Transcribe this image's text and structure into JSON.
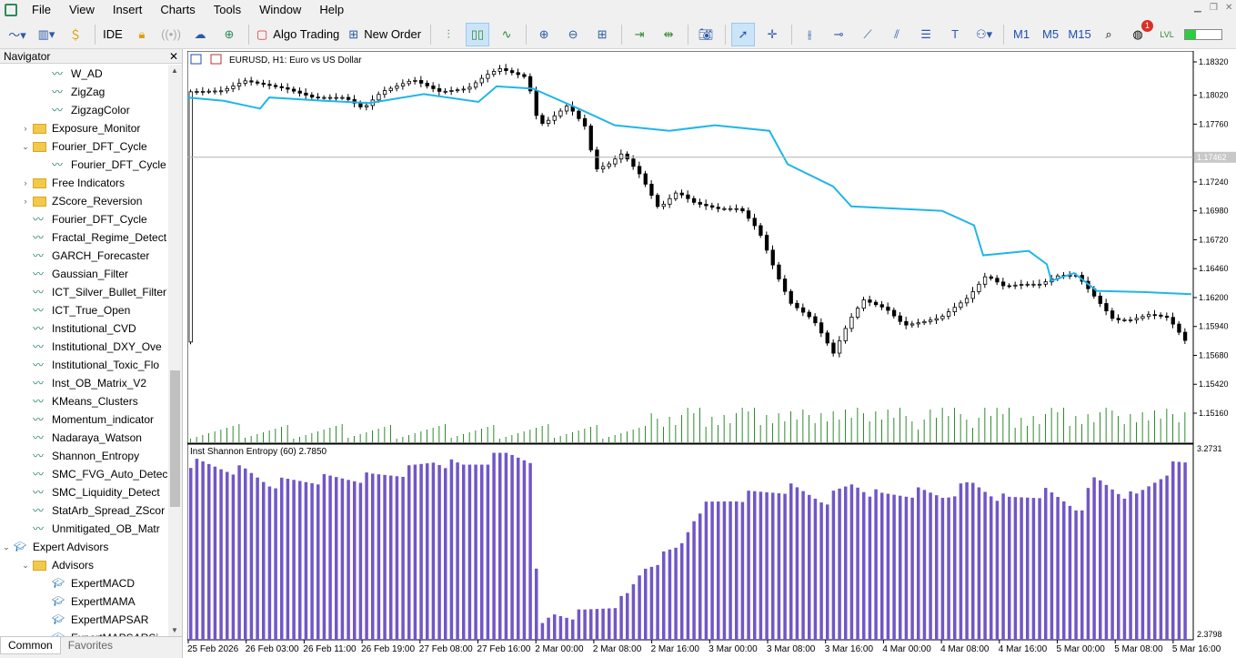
{
  "menu": {
    "items": [
      "File",
      "View",
      "Insert",
      "Charts",
      "Tools",
      "Window",
      "Help"
    ]
  },
  "toolbar": {
    "ide_label": "IDE",
    "algo_trading_label": "Algo Trading",
    "new_order_label": "New Order",
    "timeframes": [
      "M1",
      "M5",
      "M15"
    ],
    "notification_count": "1"
  },
  "navigator": {
    "title": "Navigator",
    "items": [
      {
        "label": "W_AD",
        "type": "indicator",
        "level": 2
      },
      {
        "label": "ZigZag",
        "type": "indicator",
        "level": 2
      },
      {
        "label": "ZigzagColor",
        "type": "indicator",
        "level": 2
      },
      {
        "label": "Exposure_Monitor",
        "type": "folder",
        "level": 1,
        "expander": "collapsed"
      },
      {
        "label": "Fourier_DFT_Cycle",
        "type": "folder",
        "level": 1,
        "expander": "expanded"
      },
      {
        "label": "Fourier_DFT_Cycle",
        "type": "indicator",
        "level": 2
      },
      {
        "label": "Free Indicators",
        "type": "folder",
        "level": 1,
        "expander": "collapsed"
      },
      {
        "label": "ZScore_Reversion",
        "type": "folder",
        "level": 1,
        "expander": "collapsed"
      },
      {
        "label": "Fourier_DFT_Cycle",
        "type": "indicator",
        "level": 1
      },
      {
        "label": "Fractal_Regime_Detect",
        "type": "indicator",
        "level": 1
      },
      {
        "label": "GARCH_Forecaster",
        "type": "indicator",
        "level": 1
      },
      {
        "label": "Gaussian_Filter",
        "type": "indicator",
        "level": 1
      },
      {
        "label": "ICT_Silver_Bullet_Filter",
        "type": "indicator",
        "level": 1
      },
      {
        "label": "ICT_True_Open",
        "type": "indicator",
        "level": 1
      },
      {
        "label": "Institutional_CVD",
        "type": "indicator",
        "level": 1
      },
      {
        "label": "Institutional_DXY_Ove",
        "type": "indicator",
        "level": 1
      },
      {
        "label": "Institutional_Toxic_Flo",
        "type": "indicator",
        "level": 1
      },
      {
        "label": "Inst_OB_Matrix_V2",
        "type": "indicator",
        "level": 1
      },
      {
        "label": "KMeans_Clusters",
        "type": "indicator",
        "level": 1
      },
      {
        "label": "Momentum_indicator",
        "type": "indicator",
        "level": 1
      },
      {
        "label": "Nadaraya_Watson",
        "type": "indicator",
        "level": 1
      },
      {
        "label": "Shannon_Entropy",
        "type": "indicator",
        "level": 1
      },
      {
        "label": "SMC_FVG_Auto_Detec",
        "type": "indicator",
        "level": 1
      },
      {
        "label": "SMC_Liquidity_Detect",
        "type": "indicator",
        "level": 1
      },
      {
        "label": "StatArb_Spread_ZScor",
        "type": "indicator",
        "level": 1
      },
      {
        "label": "Unmitigated_OB_Matr",
        "type": "indicator",
        "level": 1
      },
      {
        "label": "Expert Advisors",
        "type": "ea-root",
        "level": 0,
        "expander": "expanded"
      },
      {
        "label": "Advisors",
        "type": "folder",
        "level": 1,
        "expander": "expanded"
      },
      {
        "label": "ExpertMACD",
        "type": "ea",
        "level": 2
      },
      {
        "label": "ExpertMAMA",
        "type": "ea",
        "level": 2
      },
      {
        "label": "ExpertMAPSAR",
        "type": "ea",
        "level": 2
      },
      {
        "label": "ExpertMAPSARSi",
        "type": "ea",
        "level": 2
      }
    ],
    "tabs": [
      "Common",
      "Favorites"
    ],
    "active_tab": "Common"
  },
  "chart": {
    "symbol_title": "EURUSD, H1:  Euro vs US Dollar",
    "price_labels": [
      "1.18320",
      "1.18020",
      "1.17760",
      "1.17462",
      "1.17240",
      "1.16980",
      "1.16720",
      "1.16460",
      "1.16200",
      "1.15940",
      "1.15680",
      "1.15420",
      "1.15160"
    ],
    "current_price": "1.17462",
    "indicator_title": "Inst Shannon Entropy (60) 2.7850",
    "indicator_scale_max": "3.2731",
    "indicator_scale_min": "2.3798",
    "time_labels": [
      "25 Feb 2026",
      "26 Feb 03:00",
      "26 Feb 11:00",
      "26 Feb 19:00",
      "27 Feb 08:00",
      "27 Feb 16:00",
      "2 Mar 00:00",
      "2 Mar 08:00",
      "2 Mar 16:00",
      "3 Mar 00:00",
      "3 Mar 08:00",
      "3 Mar 16:00",
      "4 Mar 00:00",
      "4 Mar 08:00",
      "4 Mar 16:00",
      "5 Mar 00:00",
      "5 Mar 08:00",
      "5 Mar 16:00"
    ],
    "colors": {
      "line": "#1fb6e8",
      "histogram": "#7057c7",
      "volume": "#2e8b2e",
      "candle": "#000000"
    }
  }
}
